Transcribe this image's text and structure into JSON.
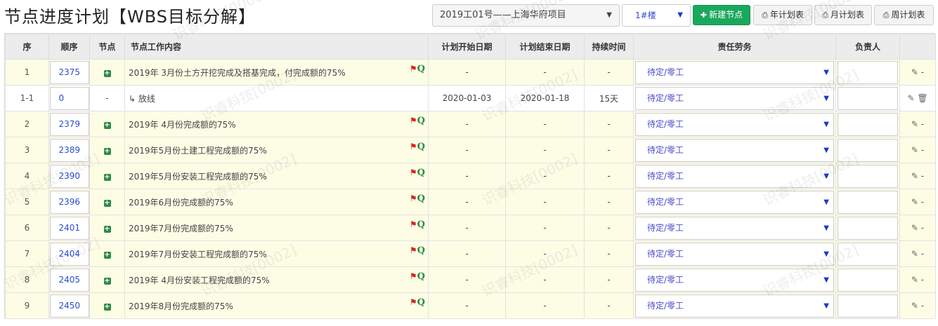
{
  "title": "节点进度计划【WBS目标分解】",
  "project_select": {
    "value": "2019工01号——上海华府项目"
  },
  "building_select": {
    "value": "1#楼"
  },
  "buttons": {
    "new_node": "新建节点",
    "year_plan": "年计划表",
    "month_plan": "月计划表",
    "week_plan": "周计划表"
  },
  "columns": {
    "seq": "序",
    "order": "顺序",
    "node": "节点",
    "content": "节点工作内容",
    "start": "计划开始日期",
    "end": "计划结束日期",
    "duration": "持续时间",
    "responsible": "责任劳务",
    "owner": "负责人",
    "ops": ""
  },
  "watermark": "识睿科技[0002]",
  "rows": [
    {
      "seq": "1",
      "order": "2375",
      "node": "+",
      "content": "2019年 3月份土方开挖完成及搭基完成，付完成额的75%",
      "start": "-",
      "end": "-",
      "duration": "-",
      "responsible": "待定/零工",
      "ops": "-"
    },
    {
      "seq": "1-1",
      "order": "0",
      "node": "-",
      "content": "↳ 放线",
      "start": "2020-01-03",
      "end": "2020-01-18",
      "duration": "15天",
      "responsible": "待定/零工",
      "ops": ""
    },
    {
      "seq": "2",
      "order": "2379",
      "node": "+",
      "content": "2019年 4月份完成额的75%",
      "start": "-",
      "end": "-",
      "duration": "-",
      "responsible": "待定/零工",
      "ops": "-"
    },
    {
      "seq": "3",
      "order": "2389",
      "node": "+",
      "content": "2019年5月份土建工程完成额的75%",
      "start": "-",
      "end": "-",
      "duration": "-",
      "responsible": "待定/零工",
      "ops": "-"
    },
    {
      "seq": "4",
      "order": "2390",
      "node": "+",
      "content": "2019年5月份安装工程完成额的75%",
      "start": "-",
      "end": "-",
      "duration": "-",
      "responsible": "待定/零工",
      "ops": "-"
    },
    {
      "seq": "5",
      "order": "2396",
      "node": "+",
      "content": "2019年6月份完成额的75%",
      "start": "-",
      "end": "-",
      "duration": "-",
      "responsible": "待定/零工",
      "ops": "-"
    },
    {
      "seq": "6",
      "order": "2401",
      "node": "+",
      "content": "2019年7月份完成额的75%",
      "start": "-",
      "end": "-",
      "duration": "-",
      "responsible": "待定/零工",
      "ops": "-"
    },
    {
      "seq": "7",
      "order": "2404",
      "node": "+",
      "content": "2019年7月份安装工程完成额的75%",
      "start": "-",
      "end": "-",
      "duration": "-",
      "responsible": "待定/零工",
      "ops": "-"
    },
    {
      "seq": "8",
      "order": "2405",
      "node": "+",
      "content": "2019年 4月份安装工程完成额的75%",
      "start": "-",
      "end": "-",
      "duration": "-",
      "responsible": "待定/零工",
      "ops": "-"
    },
    {
      "seq": "9",
      "order": "2450",
      "node": "+",
      "content": "2019年8月份完成额的75%",
      "start": "-",
      "end": "-",
      "duration": "-",
      "responsible": "待定/零工",
      "ops": "-"
    }
  ]
}
